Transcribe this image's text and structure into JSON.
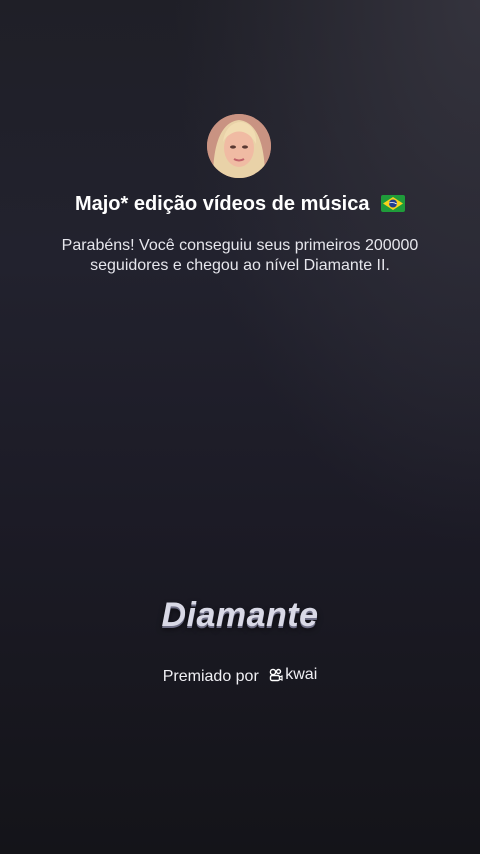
{
  "profile": {
    "username": "Majo* edição vídeos de música",
    "flag_icon": "brazil-flag-icon"
  },
  "achievement": {
    "message": "Parabéns! Você conseguiu seus primeiros 200000 seguidores e chegou ao nível Diamante II.",
    "level_title": "Diamante"
  },
  "footer": {
    "awarded_by_label": "Premiado por",
    "brand": "kwai",
    "brand_icon": "kwai-logo-icon"
  },
  "colors": {
    "background_top": "#1f1f27",
    "background_bottom": "#141419",
    "text": "#ffffff",
    "badge_text": "#d9d9e6"
  }
}
